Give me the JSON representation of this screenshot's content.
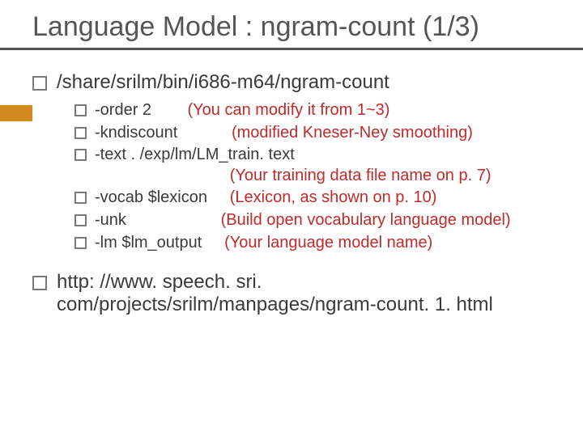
{
  "title": "Language Model : ngram-count (1/3)",
  "items": [
    {
      "text": "/share/srilm/bin/i686-m64/ngram-count",
      "sub": [
        {
          "flag": "-order 2        ",
          "note": "(You can modify it from 1~3)"
        },
        {
          "flag": "-kndiscount            ",
          "note": "(modified Kneser-Ney smoothing)"
        },
        {
          "flag": "-text . /exp/lm/LM_train. text\n                              ",
          "note": "(Your training data file name on p. 7)"
        },
        {
          "flag": "-vocab $lexicon     ",
          "note": "(Lexicon, as shown on p. 10)"
        },
        {
          "flag": "-unk                     ",
          "note": "(Build open vocabulary language model)"
        },
        {
          "flag": "-lm $lm_output     ",
          "note": "(Your language model name)"
        }
      ]
    },
    {
      "text": "http: //www. speech. sri. com/projects/srilm/manpages/ngram-count. 1. html"
    }
  ]
}
